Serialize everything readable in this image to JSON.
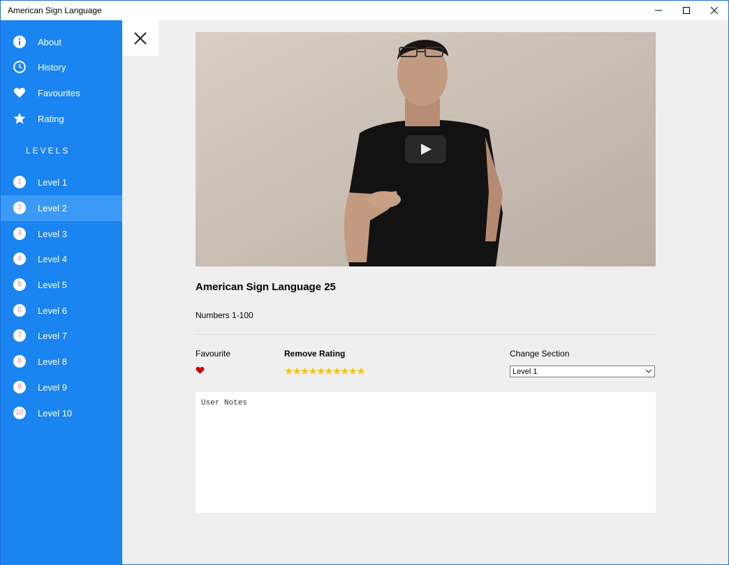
{
  "window": {
    "title": "American Sign Language"
  },
  "sidebar": {
    "items": [
      {
        "label": "About",
        "icon": "info-icon"
      },
      {
        "label": "History",
        "icon": "clock-icon"
      },
      {
        "label": "Favourites",
        "icon": "heart-icon"
      },
      {
        "label": "Rating",
        "icon": "star-icon"
      }
    ],
    "levels_header": "LEVELS",
    "levels": [
      {
        "num": "1",
        "label": "Level 1"
      },
      {
        "num": "2",
        "label": "Level 2",
        "active": true
      },
      {
        "num": "3",
        "label": "Level 3"
      },
      {
        "num": "4",
        "label": "Level 4"
      },
      {
        "num": "5",
        "label": "Level 5"
      },
      {
        "num": "6",
        "label": "Level 6"
      },
      {
        "num": "7",
        "label": "Level 7"
      },
      {
        "num": "8",
        "label": "Level 8"
      },
      {
        "num": "9",
        "label": "Level 9"
      },
      {
        "num": "10",
        "label": "Level 10"
      }
    ]
  },
  "main": {
    "video_title": "American Sign Language 25",
    "video_subtitle": "Numbers 1-100",
    "favourite_label": "Favourite",
    "rating_label": "Remove Rating",
    "rating_stars": 10,
    "section_label": "Change Section",
    "section_value": "Level 1",
    "notes_placeholder": "User Notes"
  },
  "colors": {
    "sidebar": "#1a84f0",
    "sidebar_active": "#3a9af5",
    "heart": "#d40000",
    "stars": "#f1c40f"
  }
}
